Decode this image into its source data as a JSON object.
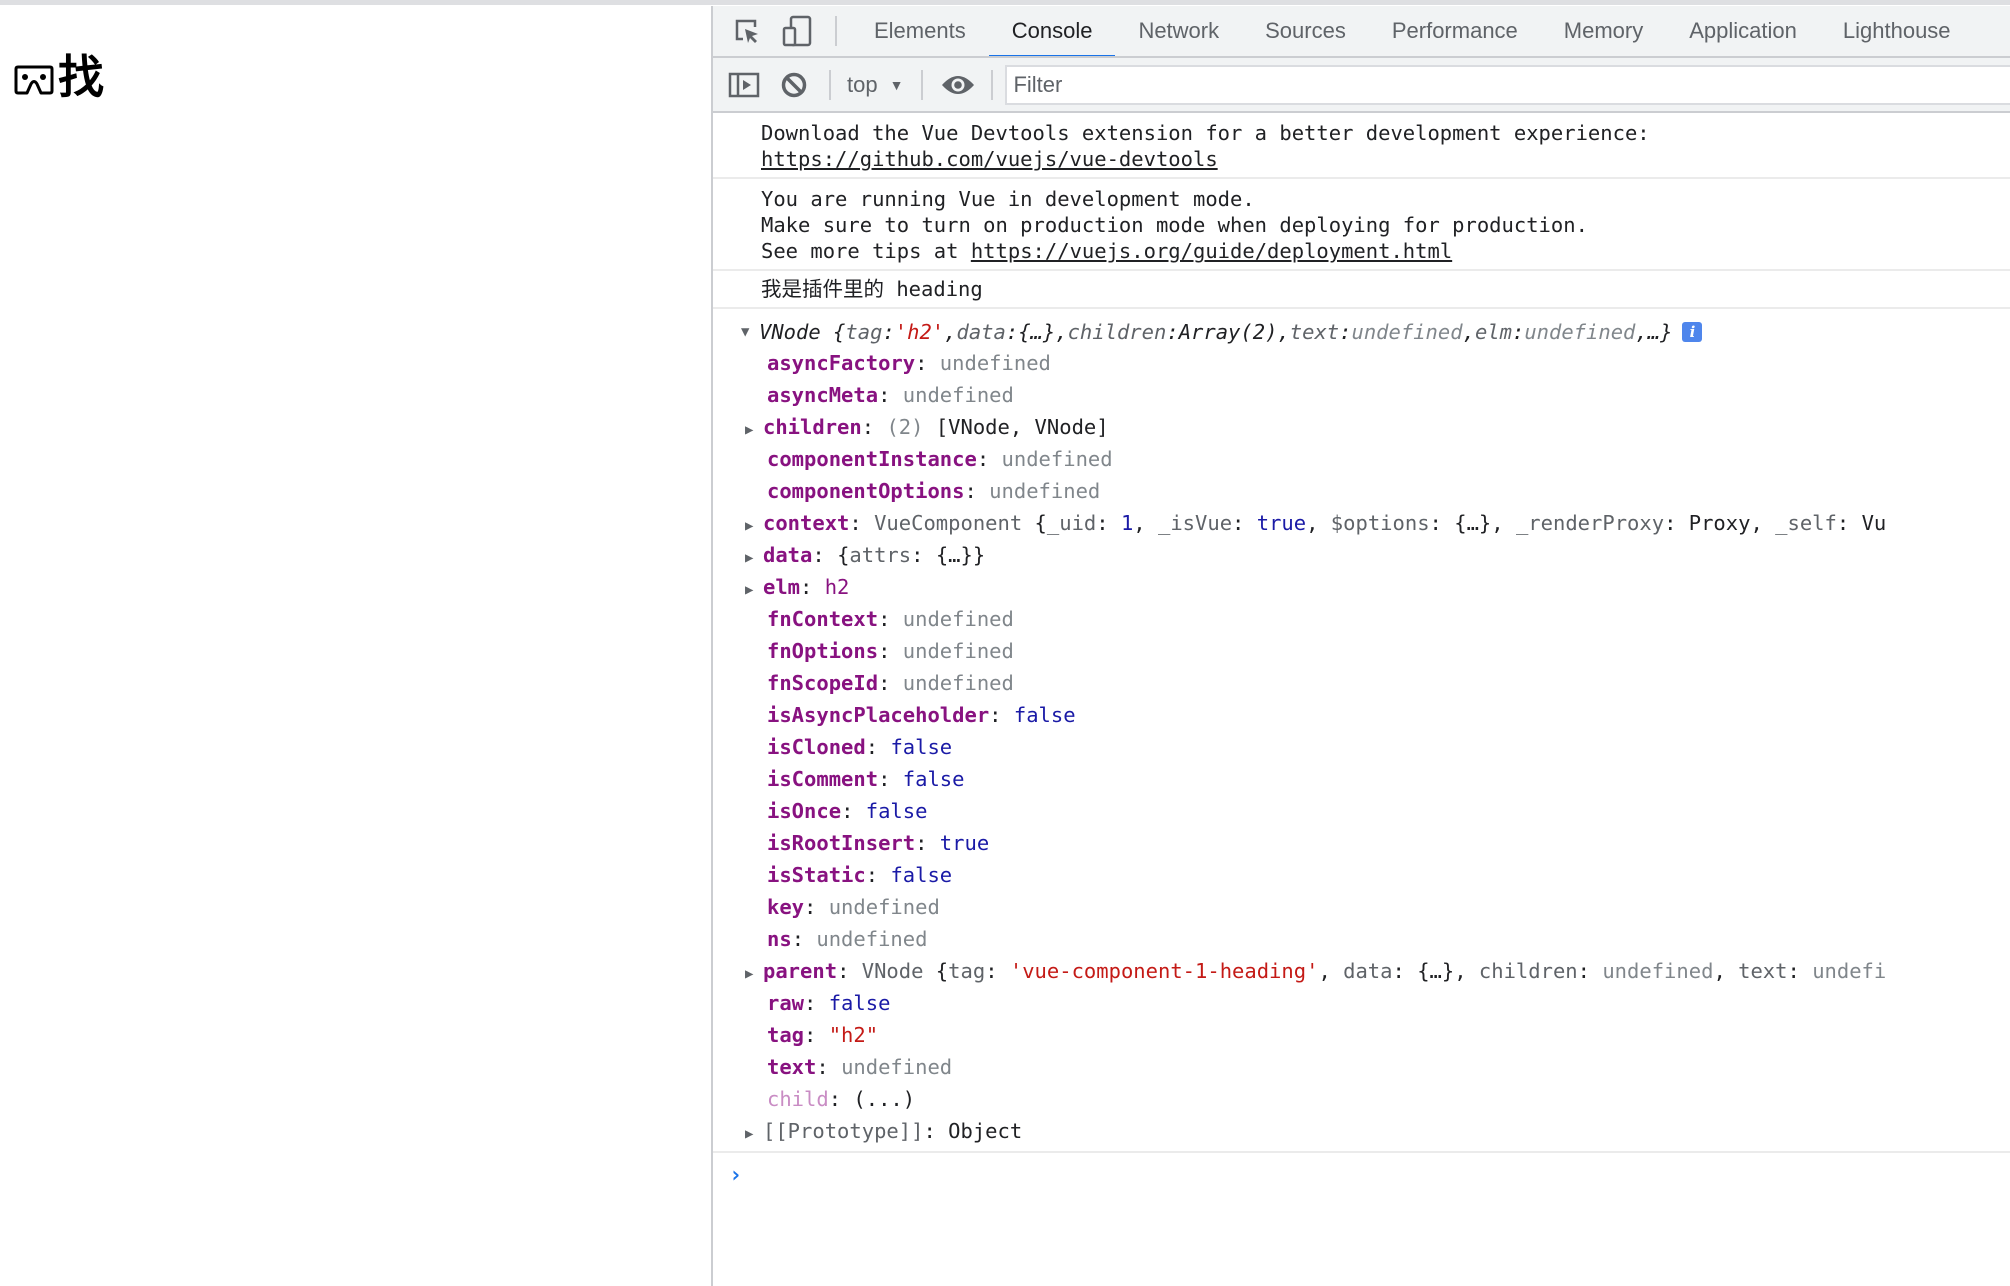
{
  "page": {
    "heading_icon": "vr-goggles-icon",
    "heading_text": "找"
  },
  "devtools": {
    "tabs": [
      {
        "label": "Elements",
        "active": false
      },
      {
        "label": "Console",
        "active": true
      },
      {
        "label": "Network",
        "active": false
      },
      {
        "label": "Sources",
        "active": false
      },
      {
        "label": "Performance",
        "active": false
      },
      {
        "label": "Memory",
        "active": false
      },
      {
        "label": "Application",
        "active": false
      },
      {
        "label": "Lighthouse",
        "active": false
      }
    ],
    "icons": {
      "inspect": "inspect-element-icon",
      "device": "device-toolbar-icon",
      "sidebar": "show-sidebar-icon",
      "clear": "clear-console-icon",
      "eye": "live-expression-icon"
    },
    "toolbar": {
      "context": "top",
      "filter_placeholder": "Filter",
      "filter_value": ""
    },
    "accent": "#1a73e8"
  },
  "console": {
    "messages": [
      {
        "line1": "Download the Vue Devtools extension for a better development experience:",
        "link": "https://github.com/vuejs/vue-devtools"
      },
      {
        "line1": "You are running Vue in development mode.",
        "line2": "Make sure to turn on production mode when deploying for production.",
        "line3_prefix": "See more tips at ",
        "link": "https://vuejs.org/guide/deployment.html"
      },
      {
        "line1": "我是插件里的 heading"
      }
    ],
    "vnode": {
      "name": "VNode",
      "preview": {
        "tag_key": "tag",
        "tag_val": "'h2'",
        "data_key": "data",
        "data_val": "{…}",
        "children_key": "children",
        "children_val": "Array(2)",
        "text_key": "text",
        "text_val": "undefined",
        "elm_key": "elm",
        "elm_val": "undefined",
        "more": "…}"
      },
      "props": {
        "asyncFactory": {
          "key": "asyncFactory",
          "val": "undefined"
        },
        "asyncMeta": {
          "key": "asyncMeta",
          "val": "undefined"
        },
        "children": {
          "key": "children",
          "count": "(2)",
          "val": "[VNode, VNode]"
        },
        "componentInstance": {
          "key": "componentInstance",
          "val": "undefined"
        },
        "componentOptions": {
          "key": "componentOptions",
          "val": "undefined"
        },
        "context": {
          "key": "context",
          "cls": "VueComponent",
          "uid_key": "_uid",
          "uid_val": "1",
          "isvue_key": "_isVue",
          "isvue_val": "true",
          "options_key": "$options",
          "options_val": "{…}",
          "proxy_key": "_renderProxy",
          "proxy_val": "Proxy",
          "self_key": "_self",
          "self_val": "Vu"
        },
        "data": {
          "key": "data",
          "val_open": "{",
          "attrs_key": "attrs",
          "attrs_val": "{…}",
          "val_close": "}"
        },
        "elm": {
          "key": "elm",
          "val": "h2"
        },
        "fnContext": {
          "key": "fnContext",
          "val": "undefined"
        },
        "fnOptions": {
          "key": "fnOptions",
          "val": "undefined"
        },
        "fnScopeId": {
          "key": "fnScopeId",
          "val": "undefined"
        },
        "isAsyncPlaceholder": {
          "key": "isAsyncPlaceholder",
          "val": "false"
        },
        "isCloned": {
          "key": "isCloned",
          "val": "false"
        },
        "isComment": {
          "key": "isComment",
          "val": "false"
        },
        "isOnce": {
          "key": "isOnce",
          "val": "false"
        },
        "isRootInsert": {
          "key": "isRootInsert",
          "val": "true"
        },
        "isStatic": {
          "key": "isStatic",
          "val": "false"
        },
        "key": {
          "key": "key",
          "val": "undefined"
        },
        "ns": {
          "key": "ns",
          "val": "undefined"
        },
        "parent": {
          "key": "parent",
          "cls": "VNode",
          "tag_key": "tag",
          "tag_val": "'vue-component-1-heading'",
          "data_key": "data",
          "data_val": "{…}",
          "children_key": "children",
          "children_val": "undefined",
          "text_key": "text",
          "text_val": "undefi"
        },
        "raw": {
          "key": "raw",
          "val": "false"
        },
        "tag": {
          "key": "tag",
          "val": "\"h2\""
        },
        "text": {
          "key": "text",
          "val": "undefined"
        },
        "child": {
          "key": "child",
          "val": "(...)"
        },
        "prototype": {
          "key": "[[Prototype]]",
          "val": "Object"
        }
      }
    },
    "prompt": "›"
  }
}
